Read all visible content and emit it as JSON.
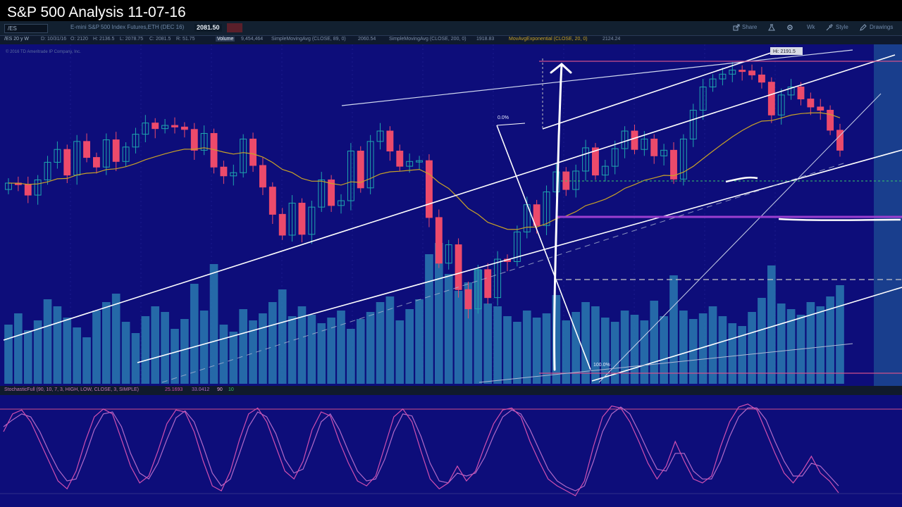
{
  "video_title": "S&P 500 Analysis 11-07-16",
  "toolbar": {
    "symbol": "/ES",
    "symbol_description": "E-mini S&P 500 Index Futures,ETH (DEC 16)",
    "last_price": "2081.50",
    "share_label": "Share",
    "wk_label": "Wk",
    "style_label": "Style",
    "drawings_label": "Drawings"
  },
  "infobar": {
    "timeframe": "/ES 20 y W",
    "date": "D: 10/31/16",
    "open": "O: 2120",
    "high": "H: 2136.5",
    "low": "L: 2078.75",
    "close": "C: 2081.5",
    "range": "R: 51.75",
    "volume_label": "Volume",
    "volume_value": "9,454,464",
    "sma1": "SimpleMovingAvg (CLOSE, 89, 0)",
    "sma1_value": "2060.54",
    "sma2": "SimpleMovingAvg (CLOSE, 200, 0)",
    "sma2_value": "1918.83",
    "ema": "MovAvgExponential (CLOSE, 20, 0)",
    "ema_value": "2124.24",
    "copyright": "© 2016 TD Ameritrade IP Company, Inc."
  },
  "annotations": {
    "high_bubble": "Hi: 2191.5",
    "fib_top": "0.0%",
    "fib_bottom": "100.0%"
  },
  "stochastic": {
    "label": "StochasticFull (90, 10, 7, 3, HIGH, LOW, CLOSE, 3, SIMPLE)",
    "fullK": "25.1693",
    "fullD": "33.0412",
    "overbought": "90",
    "oversold": "10"
  },
  "colors": {
    "panel_bg": "#0d0d7a",
    "up_candle": "#1fa6ad",
    "down_candle": "#ec4a6b",
    "volume_bar": "#2a7ab0",
    "ema_line": "#c9a227",
    "stoch_k": "#d04fb0",
    "stoch_d": "#b06ac8",
    "trendline": "#ffffff",
    "horizontal_magenta": "#9b3fd0",
    "green_dotted": "#39c86a"
  },
  "chart_data": {
    "type": "candlestick",
    "timeframe": "weekly",
    "close_series": [
      2040,
      2038,
      2025,
      2044,
      2066,
      2082,
      2050,
      2092,
      2072,
      2060,
      2094,
      2067,
      2085,
      2101,
      2115,
      2108,
      2112,
      2110,
      2107,
      2081,
      2102,
      2060,
      2049,
      2053,
      2095,
      2062,
      2035,
      2001,
      1975,
      2015,
      1976,
      2010,
      2044,
      2012,
      2018,
      2080,
      2034,
      2092,
      2105,
      2080,
      2061,
      2067,
      2068,
      1997,
      1940,
      1963,
      1907,
      1883,
      1932,
      1897,
      1945,
      1942,
      1979,
      2013,
      1987,
      2029,
      2054,
      2032,
      2055,
      2084,
      2050,
      2061,
      2083,
      2105,
      2082,
      2095,
      2074,
      2081,
      2045,
      2095,
      2131,
      2160,
      2170,
      2176,
      2181,
      2180,
      2175,
      2166,
      2125,
      2150,
      2160,
      2145,
      2135,
      2131,
      2106,
      2081
    ],
    "volume_series": [
      0.42,
      0.5,
      0.38,
      0.45,
      0.6,
      0.55,
      0.47,
      0.4,
      0.33,
      0.52,
      0.58,
      0.64,
      0.44,
      0.36,
      0.48,
      0.55,
      0.51,
      0.39,
      0.46,
      0.71,
      0.52,
      0.85,
      0.42,
      0.37,
      0.53,
      0.45,
      0.5,
      0.58,
      0.67,
      0.48,
      0.55,
      0.49,
      0.43,
      0.47,
      0.52,
      0.39,
      0.46,
      0.51,
      0.58,
      0.62,
      0.45,
      0.53,
      0.6,
      0.92,
      1.0,
      0.78,
      0.66,
      0.72,
      0.81,
      0.57,
      0.55,
      0.48,
      0.44,
      0.52,
      0.47,
      0.5,
      0.63,
      0.45,
      0.51,
      0.58,
      0.55,
      0.47,
      0.44,
      0.52,
      0.49,
      0.45,
      0.59,
      0.48,
      0.77,
      0.52,
      0.46,
      0.5,
      0.55,
      0.48,
      0.43,
      0.41,
      0.51,
      0.61,
      0.84,
      0.57,
      0.53,
      0.49,
      0.58,
      0.55,
      0.62,
      0.7
    ],
    "ylim": [
      1800,
      2200
    ],
    "stoch_k": [
      70,
      88,
      92,
      80,
      60,
      40,
      20,
      12,
      30,
      60,
      85,
      93,
      88,
      62,
      35,
      18,
      25,
      50,
      78,
      92,
      90,
      70,
      40,
      15,
      10,
      30,
      62,
      88,
      94,
      80,
      55,
      30,
      22,
      40,
      72,
      90,
      86,
      60,
      38,
      20,
      15,
      25,
      55,
      85,
      93,
      80,
      50,
      22,
      12,
      18,
      35,
      20,
      30,
      55,
      78,
      92,
      94,
      85,
      60,
      40,
      22,
      15,
      10,
      5,
      20,
      55,
      85,
      96,
      94,
      80,
      60,
      38,
      22,
      35,
      60,
      40,
      22,
      18,
      25,
      55,
      80,
      95,
      98,
      92,
      70,
      48,
      28,
      18,
      30,
      45,
      28,
      20,
      8
    ],
    "stoch_d": [
      75,
      82,
      88,
      85,
      70,
      50,
      32,
      20,
      22,
      45,
      72,
      88,
      90,
      75,
      48,
      28,
      22,
      38,
      62,
      84,
      91,
      80,
      55,
      28,
      15,
      22,
      48,
      75,
      90,
      85,
      68,
      42,
      28,
      32,
      55,
      80,
      88,
      72,
      50,
      30,
      20,
      22,
      42,
      70,
      88,
      86,
      65,
      38,
      20,
      18,
      28,
      25,
      28,
      44,
      66,
      85,
      92,
      88,
      72,
      52,
      32,
      20,
      14,
      10,
      15,
      40,
      70,
      88,
      95,
      88,
      70,
      50,
      32,
      30,
      48,
      48,
      30,
      22,
      22,
      40,
      65,
      85,
      94,
      94,
      82,
      60,
      40,
      25,
      25,
      38,
      35,
      25,
      15
    ]
  }
}
